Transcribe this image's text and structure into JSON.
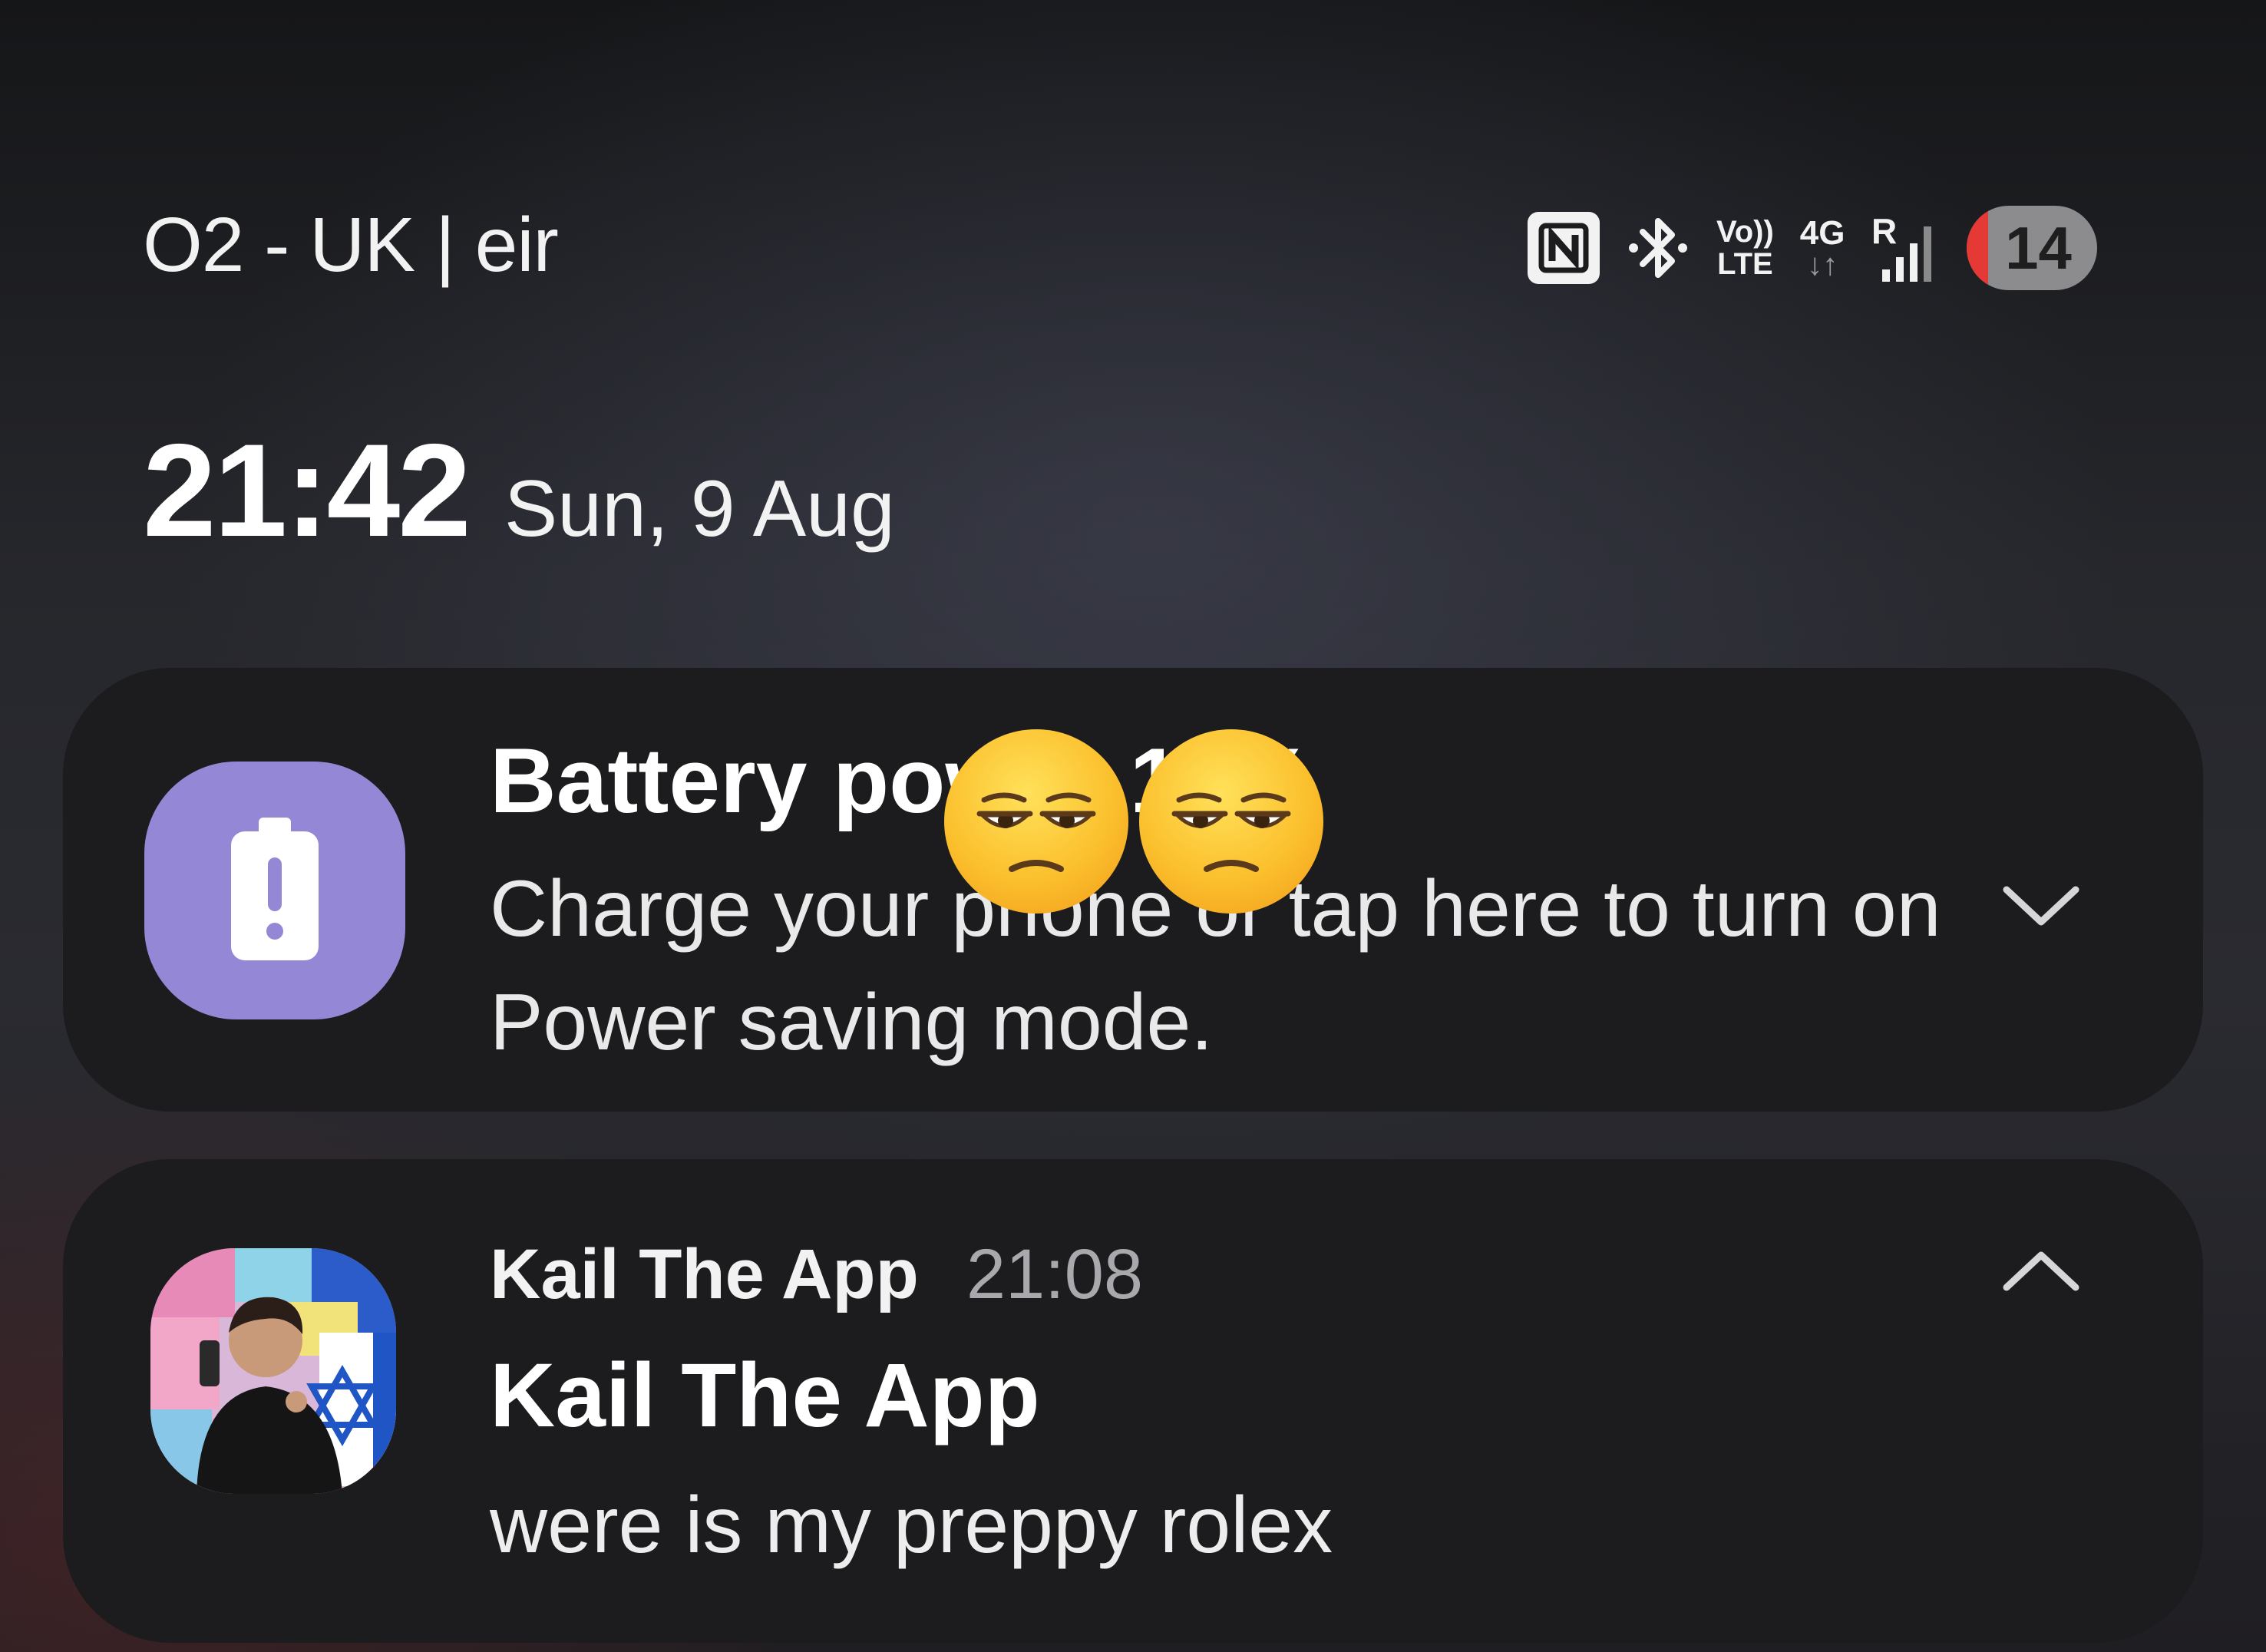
{
  "status_bar": {
    "carrier": "O2 - UK | eir",
    "volte_top": "Vo))",
    "volte_bottom": "LTE",
    "network_type": "4G",
    "network_arrows": "↓↑",
    "roaming": "R",
    "battery_level": "14",
    "battery_color": "#e53935",
    "icons": [
      "nfc-icon",
      "bluetooth-icon",
      "volte-icon",
      "network-4g-icon",
      "signal-icon",
      "battery-icon"
    ]
  },
  "clock": {
    "time": "21:42",
    "date": "Sun, 9 Aug"
  },
  "notifications": [
    {
      "app_icon": "battery-alert-icon",
      "icon_color": "#9488d6",
      "title": "Battery power 14%",
      "body": "Charge your phone or tap here to turn on Power saving mode.",
      "chevron": "chevron-down-icon"
    },
    {
      "app_icon": "contact-avatar",
      "app_name": "Kail The App",
      "time": "21:08",
      "sender": "Kail The App",
      "message": "were is my preppy rolex",
      "chevron": "chevron-up-icon"
    }
  ],
  "overlay": {
    "emoji": [
      "unamused-face-emoji",
      "unamused-face-emoji"
    ]
  }
}
